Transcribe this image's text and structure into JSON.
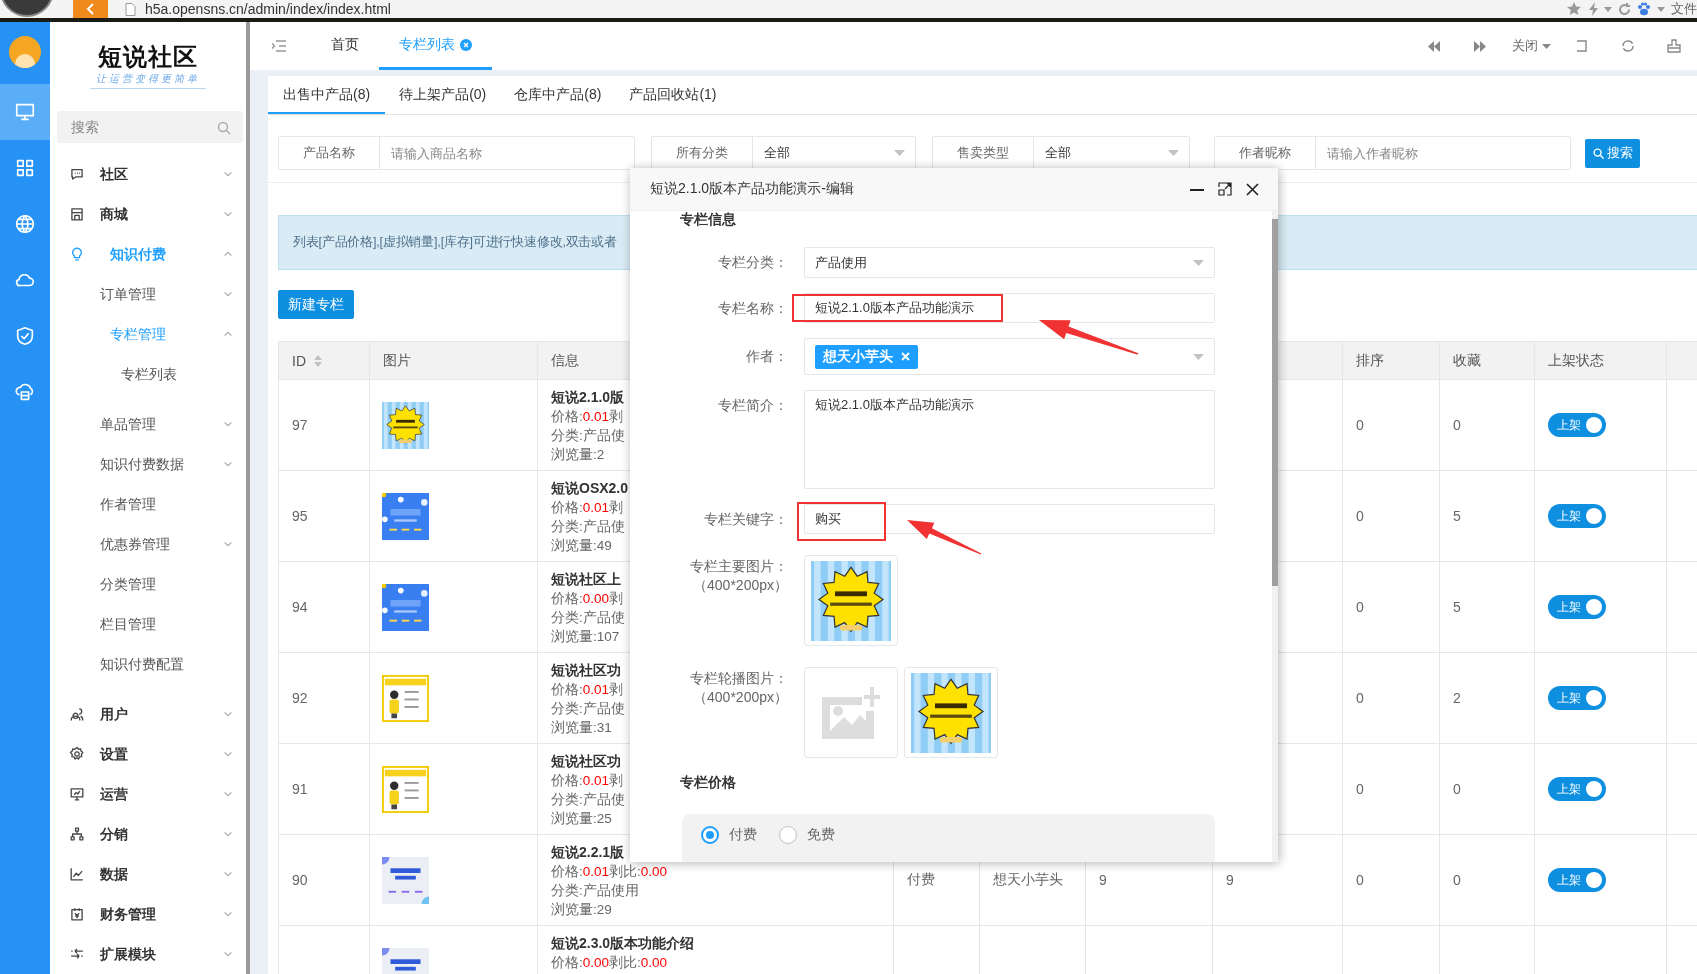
{
  "browser": {
    "url": "h5a.opensns.cn/admin/index/index.html",
    "menu_label": "文件"
  },
  "rail": [
    {
      "selected": true
    },
    {
      "selected": false
    },
    {
      "selected": false
    },
    {
      "selected": false
    },
    {
      "selected": false
    },
    {
      "selected": false
    }
  ],
  "brand": {
    "name": "短说社区",
    "slogan": "让运营变得更简单"
  },
  "sidebar": {
    "search_placeholder": "搜索",
    "items": [
      {
        "label": "社区",
        "kind": "menu",
        "expanded": false,
        "selected": false
      },
      {
        "label": "商城",
        "kind": "menu",
        "expanded": false,
        "selected": false
      },
      {
        "label": "知识付费",
        "kind": "menu",
        "expanded": true,
        "selected": true,
        "children": [
          {
            "label": "订单管理",
            "kind": "menu",
            "expanded": false,
            "selected": false
          },
          {
            "label": "专栏管理",
            "kind": "menu",
            "expanded": true,
            "selected": true,
            "children": [
              {
                "label": "专栏列表",
                "selected": false
              }
            ]
          },
          {
            "label": "单品管理",
            "kind": "menu",
            "expanded": false,
            "selected": false
          },
          {
            "label": "知识付费数据",
            "kind": "menu",
            "expanded": false,
            "selected": false
          },
          {
            "label": "作者管理",
            "kind": "link",
            "selected": false
          },
          {
            "label": "优惠券管理",
            "kind": "menu",
            "expanded": false,
            "selected": false
          },
          {
            "label": "分类管理",
            "kind": "link",
            "selected": false
          },
          {
            "label": "栏目管理",
            "kind": "link",
            "selected": false
          },
          {
            "label": "知识付费配置",
            "kind": "link",
            "selected": false
          }
        ]
      },
      {
        "label": "用户",
        "kind": "menu",
        "expanded": false,
        "selected": false
      },
      {
        "label": "设置",
        "kind": "menu",
        "expanded": false,
        "selected": false
      },
      {
        "label": "运营",
        "kind": "menu",
        "expanded": false,
        "selected": false
      },
      {
        "label": "分销",
        "kind": "menu",
        "expanded": false,
        "selected": false
      },
      {
        "label": "数据",
        "kind": "menu",
        "expanded": false,
        "selected": false
      },
      {
        "label": "财务管理",
        "kind": "menu",
        "expanded": false,
        "selected": false
      },
      {
        "label": "扩展模块",
        "kind": "menu",
        "expanded": false,
        "selected": false
      }
    ]
  },
  "top_tabs": [
    {
      "label": "首页",
      "selected": false,
      "closable": false
    },
    {
      "label": "专栏列表",
      "selected": true,
      "closable": true
    }
  ],
  "toolbar": {
    "close_menu": "关闭"
  },
  "sub_tabs": [
    {
      "label": "出售中产品(8)",
      "selected": true
    },
    {
      "label": "待上架产品(0)",
      "selected": false
    },
    {
      "label": "仓库中产品(8)",
      "selected": false
    },
    {
      "label": "产品回收站(1)",
      "selected": false
    }
  ],
  "filters": [
    {
      "kind": "input",
      "label": "产品名称",
      "placeholder": "请输入商品名称"
    },
    {
      "kind": "select",
      "label": "所有分类",
      "value": "全部"
    },
    {
      "kind": "select",
      "label": "售卖类型",
      "value": "全部"
    },
    {
      "kind": "input",
      "label": "作者昵称",
      "placeholder": "请输入作者昵称"
    }
  ],
  "search_button": "搜索",
  "notice": "列表[产品价格],[虚拟销量],[库存]可进行快速修改,双击或者",
  "new_button": "新建专栏",
  "table": {
    "columns": {
      "id": "ID",
      "picture": "图片",
      "info": "信息",
      "sort": "排序",
      "favorites": "收藏",
      "status": "上架状态"
    },
    "rows": [
      {
        "id": "97",
        "info": {
          "title": "短说2.1.0版",
          "price_label": "价格:",
          "price": "0.01",
          "ratio_label": "剥",
          "category": "分类:产品使",
          "views": "浏览量:2"
        },
        "sort": "0",
        "favorites": "0",
        "on_shelf": true,
        "switch_label": "上架"
      },
      {
        "id": "95",
        "info": {
          "title": "短说OSX2.0",
          "price_label": "价格:",
          "price": "0.01",
          "ratio_label": "剥",
          "category": "分类:产品使",
          "views": "浏览量:49"
        },
        "sort": "0",
        "favorites": "5",
        "on_shelf": true,
        "switch_label": "上架"
      },
      {
        "id": "94",
        "info": {
          "title": "短说社区上",
          "price_label": "价格:",
          "price": "0.00",
          "ratio_label": "剥",
          "category": "分类:产品使",
          "views": "浏览量:107"
        },
        "sort": "0",
        "favorites": "5",
        "on_shelf": true,
        "switch_label": "上架"
      },
      {
        "id": "92",
        "info": {
          "title": "短说社区功",
          "price_label": "价格:",
          "price": "0.01",
          "ratio_label": "剥",
          "category": "分类:产品使",
          "views": "浏览量:31"
        },
        "sort": "0",
        "favorites": "2",
        "on_shelf": true,
        "switch_label": "上架"
      },
      {
        "id": "91",
        "info": {
          "title": "短说社区功",
          "price_label": "价格:",
          "price": "0.01",
          "ratio_label": "剥",
          "category": "分类:产品使",
          "views": "浏览量:25"
        },
        "sort": "0",
        "favorites": "0",
        "on_shelf": true,
        "switch_label": "上架"
      },
      {
        "id": "90",
        "info": {
          "title": "短说2.2.1版",
          "price_label": "价格:",
          "price": "0.01",
          "ratio_label": "剥比:",
          "ratio": "0.00",
          "category": "分类:产品使用",
          "views": "浏览量:29"
        },
        "type": "付费",
        "author": "想天小芋头",
        "column_7": "9",
        "column_8": "9",
        "sort": "0",
        "favorites": "0",
        "on_shelf": true,
        "switch_label": "上架"
      },
      {
        "info": {
          "title": "短说2.3.0版本功能介绍",
          "price_label": "价格:",
          "price": "0.00",
          "ratio_label": "剥比:",
          "ratio": "0.00"
        }
      }
    ]
  },
  "dialog": {
    "title": "短说2.1.0版本产品功能演示-编辑",
    "section_info": "专栏信息",
    "fields": [
      {
        "kind": "select",
        "label": "专栏分类：",
        "value": "产品使用"
      },
      {
        "kind": "input",
        "label": "专栏名称：",
        "value": "短说2.1.0版本产品功能演示"
      },
      {
        "kind": "tags",
        "label": "作者：",
        "tags": [
          "想天小芋头"
        ]
      },
      {
        "kind": "textarea",
        "label": "专栏简介：",
        "value": "短说2.1.0版本产品功能演示"
      },
      {
        "kind": "input",
        "label": "专栏关键字：",
        "value": "购买"
      },
      {
        "kind": "images",
        "label": "专栏主要图片：",
        "hint": "（400*200px）",
        "images": [
          {
            "kind": "picture"
          }
        ]
      },
      {
        "kind": "images",
        "label": "专栏轮播图片：",
        "hint": "（400*200px）",
        "images": [
          {
            "kind": "upload"
          },
          {
            "kind": "picture"
          }
        ]
      }
    ],
    "section_price": "专栏价格",
    "price_options": [
      {
        "label": "付费",
        "selected": true
      },
      {
        "label": "免费",
        "selected": false
      }
    ]
  }
}
